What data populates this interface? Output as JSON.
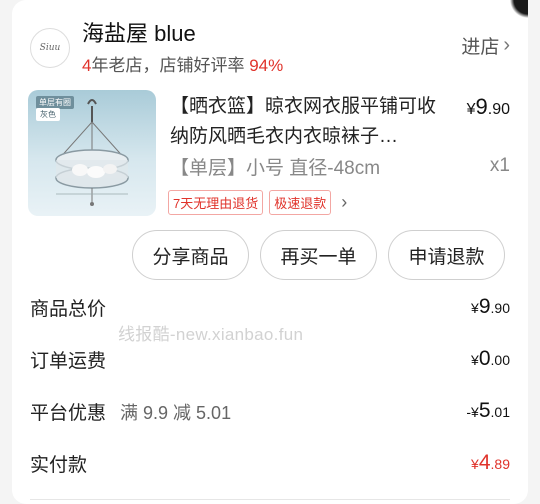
{
  "shop": {
    "logo_text": "Siuu",
    "name": "海盐屋 blue",
    "years": "4",
    "years_suffix": "年老店，店铺好评率",
    "rating": "94%",
    "enter_label": "进店",
    "enter_chevron": "›"
  },
  "product": {
    "image_tag_1": "单层有圈",
    "image_tag_2": "灰色",
    "title": "【晒衣篮】晾衣网衣服平铺可收纳防风晒毛衣内衣晾袜子…",
    "price_symbol": "¥",
    "price_int": "9",
    "price_dec": ".90",
    "spec": "【单层】小号 直径-48cm",
    "qty": "x1",
    "badges": [
      "7天无理由退货",
      "极速退款"
    ],
    "badge_chevron": "›"
  },
  "actions": {
    "share": "分享商品",
    "rebuy": "再买一单",
    "refund": "申请退款"
  },
  "summary": {
    "total_label": "商品总价",
    "total_symbol": "¥",
    "total_int": "9",
    "total_dec": ".90",
    "shipping_label": "订单运费",
    "shipping_symbol": "¥",
    "shipping_int": "0",
    "shipping_dec": ".00",
    "discount_label": "平台优惠",
    "discount_detail": "满 9.9 减 5.01",
    "discount_symbol": "-¥",
    "discount_int": "5",
    "discount_dec": ".01",
    "paid_label": "实付款",
    "paid_symbol": "¥",
    "paid_int": "4",
    "paid_dec": ".89"
  },
  "watermark": "线报酷-new.xianbao.fun",
  "colors": {
    "accent_red": "#e0332b",
    "text_dark": "#222222",
    "text_gray": "#888888"
  }
}
